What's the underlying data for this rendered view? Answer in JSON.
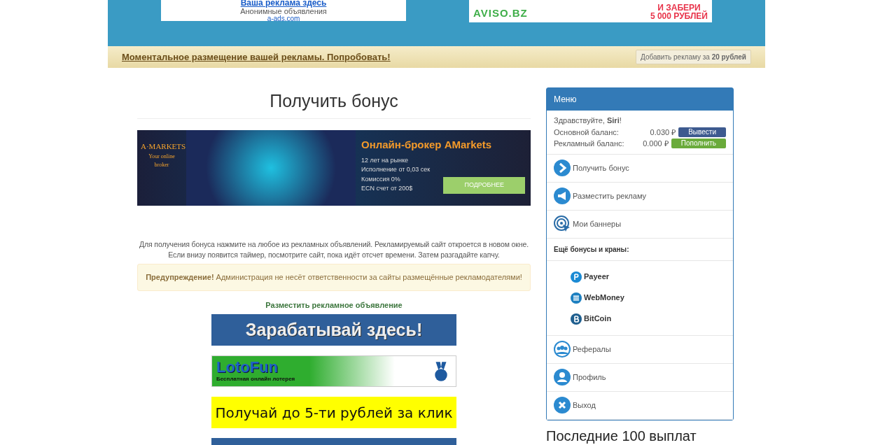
{
  "header_ads": [
    {
      "kind": "text",
      "title": "Ваша реклама здесь",
      "subtitle": "Анонимные объявления",
      "url": "a-ads.com"
    },
    {
      "kind": "aviso",
      "logo": "AVISO.BZ",
      "lines": [
        "И ЗАБЕРИ",
        "5 000 РУБЛЕЙ"
      ]
    }
  ],
  "promo_bar": {
    "link": "Моментальное размещение вашей рекламы. Попробовать!",
    "button": "Добавить рекламу за **20 рублей**"
  },
  "page_title": "Получить бонус",
  "broker_ad": {
    "logo": "A·MARKETS",
    "tagline": "Your online broker",
    "headline": "Онлайн-брокер AMarkets",
    "facts": [
      "12 лет на рынке",
      "Исполнение от 0,03 сек",
      "Комиссия 0%",
      "ECN счет от 200$"
    ],
    "button": "ПОДРОБНЕЕ"
  },
  "instructions": "Для получения бонуса нажмите на любое из рекламных объявлений. Рекламируемый сайт откроется в новом окне. Если внизу появится таймер, посмотрите сайт, пока идёт отсчет времени. Затем разгадайте капчу.",
  "warning": "**Предупреждение!** Администрация не несёт ответственности за сайты размещённые рекламодателями!",
  "place_ad_link": "Разместить рекламное объявление",
  "banners": [
    {
      "kind": "blue",
      "text": "Зарабатывай здесь!"
    },
    {
      "kind": "lotofun",
      "text": "LotoFun",
      "subtext": "Бесплатная онлайн лотерея"
    },
    {
      "kind": "yellow",
      "text": "Получай до 5-ти рублей за клик"
    },
    {
      "kind": "blue"
    }
  ],
  "menu": {
    "title": "Меню",
    "greeting": "Здравствуйте, **Siri**!",
    "balances": [
      {
        "label": "Основной баланс:",
        "value": "0.030 ₽",
        "button": "Вывести",
        "kind": "withdraw"
      },
      {
        "label": "Рекламный баланс:",
        "value": "0.000 ₽",
        "button": "Пополнить",
        "kind": "topup"
      }
    ],
    "items": [
      {
        "kind": "bonus",
        "label": "Получить бонус"
      },
      {
        "kind": "megaphone",
        "label": "Разместить рекламу"
      },
      {
        "kind": "target",
        "label": "Мои баннеры"
      }
    ],
    "faucets_title": "Ещё бонусы и краны:",
    "faucets": [
      {
        "kind": "payeer",
        "label": "Payeer"
      },
      {
        "kind": "webmoney",
        "label": "WebMoney"
      },
      {
        "kind": "bitcoin",
        "label": "BitCoin"
      }
    ],
    "items2": [
      {
        "kind": "referrals",
        "label": "Рефералы"
      },
      {
        "kind": "profile",
        "label": "Профиль"
      },
      {
        "kind": "logout",
        "label": "Выход"
      }
    ]
  },
  "payouts_title": "Последние 100 выплат"
}
